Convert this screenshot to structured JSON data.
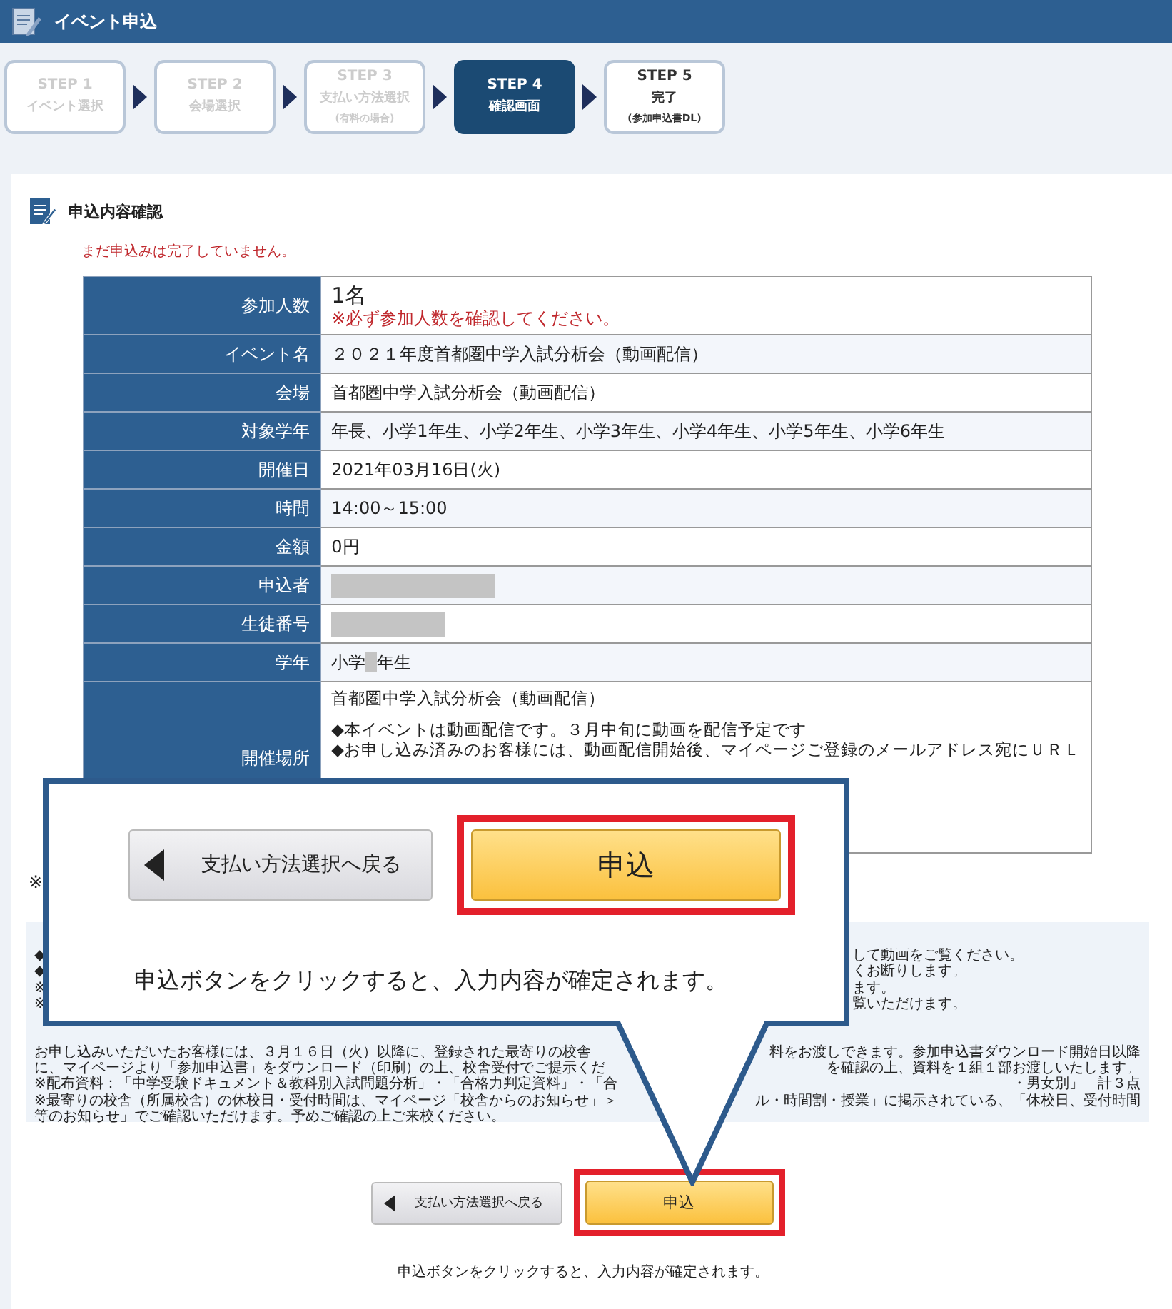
{
  "header": {
    "title": "イベント申込"
  },
  "steps": [
    {
      "label": "STEP 1",
      "name": "イベント選択",
      "selected": false,
      "disabled": true
    },
    {
      "label": "STEP 2",
      "name": "会場選択",
      "selected": false,
      "disabled": true
    },
    {
      "label": "STEP 3",
      "name": "支払い方法選択",
      "sub": "(有料の場合)",
      "selected": false,
      "disabled": true
    },
    {
      "label": "STEP 4",
      "name": "確認画面",
      "selected": true,
      "disabled": false
    },
    {
      "label": "STEP 5",
      "name": "完了",
      "sub": "(参加申込書DL)",
      "selected": false,
      "disabled": false
    }
  ],
  "section": {
    "title": "申込内容確認",
    "warning": "まだ申込みは完了していません。"
  },
  "table": {
    "rows": [
      {
        "label": "参加人数",
        "kind": "count",
        "value": "1名",
        "note": "※必ず参加人数を確認してください。"
      },
      {
        "label": "イベント名",
        "kind": "text",
        "value": "２０２１年度首都圏中学入試分析会（動画配信）"
      },
      {
        "label": "会場",
        "kind": "text",
        "value": "首都圏中学入試分析会（動画配信）"
      },
      {
        "label": "対象学年",
        "kind": "text",
        "value": "年長、小学1年生、小学2年生、小学3年生、小学4年生、小学5年生、小学6年生"
      },
      {
        "label": "開催日",
        "kind": "text",
        "value": "2021年03月16日(火)"
      },
      {
        "label": "時間",
        "kind": "text",
        "value": "14:00～15:00"
      },
      {
        "label": "金額",
        "kind": "text",
        "value": "0円"
      },
      {
        "label": "申込者",
        "kind": "redacted-name"
      },
      {
        "label": "生徒番号",
        "kind": "redacted-id"
      },
      {
        "label": "学年",
        "kind": "partly-redacted",
        "before": "小学",
        "after": "年生"
      },
      {
        "label": "開催場所",
        "kind": "lines",
        "lines": [
          "首都圏中学入試分析会（動画配信）",
          "◆本イベントは動画配信です。３月中旬に動画を配信予定です",
          "◆お申し込み済みのお客様には、動画配信開始後、マイページご登録のメールアドレス宛にＵＲＬ"
        ]
      }
    ]
  },
  "footnote_mark": "※",
  "notes": {
    "lines": [
      {
        "kind": "aside",
        "left": "◆",
        "right": "して動画をご覧ください。"
      },
      {
        "kind": "aside",
        "left": "◆",
        "right": "くお断りします。"
      },
      {
        "kind": "aside",
        "left": "※",
        "right": "ます。"
      },
      {
        "kind": "aside",
        "left": "※",
        "right": "覧いただけます。"
      },
      {
        "kind": "split",
        "left": "お申し込みいただいたお客様には、３月１６日（火）以降に、登録された最寄りの校舎",
        "right": "料をお渡しできます。参加申込書ダウンロード開始日以降"
      },
      {
        "kind": "split",
        "left": "に、マイページより「参加申込書」をダウンロード（印刷）の上、校舎受付でご提示くだ",
        "right": "を確認の上、資料を１組１部お渡しいたします。"
      },
      {
        "kind": "split",
        "left": "※配布資料：「中学受験ドキュメント＆教科別入試問題分析」・「合格力判定資料」・「合",
        "right": "・男女別」　計３点"
      },
      {
        "kind": "split",
        "left": "※最寄りの校舎（所属校舎）の休校日・受付時間は、マイページ「校舎からのお知らせ」＞",
        "right": "ル・時間割・授業」に掲示されている、「休校日、受付時間"
      },
      {
        "kind": "split",
        "left": "等のお知らせ」でご確認いただけます。予めご確認の上ご来校ください。"
      }
    ]
  },
  "actions": {
    "back": "支払い方法選択へ戻る",
    "submit": "申込",
    "hint": "申込ボタンをクリックすると、入力内容が確定されます。"
  },
  "callout": {
    "back": "支払い方法選択へ戻る",
    "submit": "申込",
    "hint": "申込ボタンをクリックすると、入力内容が確定されます。"
  }
}
